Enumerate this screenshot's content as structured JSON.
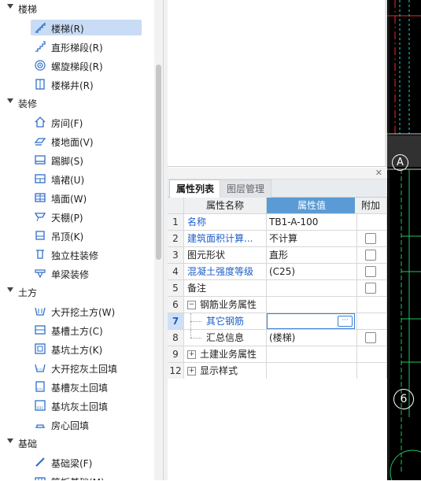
{
  "tree": {
    "groups": [
      {
        "label": "楼梯",
        "items": [
          {
            "label": "楼梯(R)",
            "icon": "stair-icon",
            "selected": true
          },
          {
            "label": "直形梯段(R)",
            "icon": "straight-flight-icon"
          },
          {
            "label": "螺旋梯段(R)",
            "icon": "spiral-flight-icon"
          },
          {
            "label": "楼梯井(R)",
            "icon": "stairwell-icon"
          }
        ]
      },
      {
        "label": "装修",
        "items": [
          {
            "label": "房间(F)",
            "icon": "room-icon"
          },
          {
            "label": "楼地面(V)",
            "icon": "floor-surface-icon"
          },
          {
            "label": "踢脚(S)",
            "icon": "skirting-icon"
          },
          {
            "label": "墙裙(U)",
            "icon": "dado-icon"
          },
          {
            "label": "墙面(W)",
            "icon": "wall-surface-icon"
          },
          {
            "label": "天棚(P)",
            "icon": "ceiling-icon"
          },
          {
            "label": "吊顶(K)",
            "icon": "suspended-ceiling-icon"
          },
          {
            "label": "独立柱装修",
            "icon": "column-finish-icon"
          },
          {
            "label": "单梁装修",
            "icon": "beam-finish-icon"
          }
        ]
      },
      {
        "label": "土方",
        "items": [
          {
            "label": "大开挖土方(W)",
            "icon": "mass-excavation-icon"
          },
          {
            "label": "基槽土方(C)",
            "icon": "trench-excavation-icon"
          },
          {
            "label": "基坑土方(K)",
            "icon": "pit-excavation-icon"
          },
          {
            "label": "大开挖灰土回填",
            "icon": "mass-backfill-icon"
          },
          {
            "label": "基槽灰土回填",
            "icon": "trench-backfill-icon"
          },
          {
            "label": "基坑灰土回填",
            "icon": "pit-backfill-icon"
          },
          {
            "label": "房心回填",
            "icon": "room-backfill-icon"
          }
        ]
      },
      {
        "label": "基础",
        "items": [
          {
            "label": "基础梁(F)",
            "icon": "foundation-beam-icon"
          },
          {
            "label": "筏板基础(M)",
            "icon": "raft-foundation-icon"
          }
        ]
      }
    ]
  },
  "properties": {
    "tabs": [
      "属性列表",
      "图层管理"
    ],
    "headers": {
      "name": "属性名称",
      "value": "属性值",
      "add": "附加"
    },
    "rows": [
      {
        "num": "1",
        "name": "名称",
        "value": "TB1-A-100",
        "blue": true,
        "check": false
      },
      {
        "num": "2",
        "name": "建筑面积计算...",
        "value": "不计算",
        "blue": true,
        "check": true
      },
      {
        "num": "3",
        "name": "图元形状",
        "value": "直形",
        "blue": false,
        "check": true
      },
      {
        "num": "4",
        "name": "混凝土强度等级",
        "value": "(C25)",
        "blue": true,
        "check": true
      },
      {
        "num": "5",
        "name": "备注",
        "value": "",
        "blue": false,
        "check": true
      },
      {
        "num": "6",
        "name": "钢筋业务属性",
        "value": "",
        "blue": false,
        "check": false,
        "expander": "−"
      },
      {
        "num": "7",
        "name": "其它钢筋",
        "value": "",
        "blue": true,
        "check": false,
        "active": true
      },
      {
        "num": "8",
        "name": "汇总信息",
        "value": "(楼梯)",
        "blue": false,
        "check": true
      },
      {
        "num": "9",
        "name": "土建业务属性",
        "value": "",
        "blue": false,
        "check": false,
        "expander": "+"
      },
      {
        "num": "12",
        "name": "显示样式",
        "value": "",
        "blue": false,
        "check": false,
        "expander": "+"
      }
    ]
  },
  "cad": {
    "axis_label_a": "A",
    "axis_label_6": "6"
  },
  "colors": {
    "selection": "#c9dcf5",
    "header_value": "#5b9bd5",
    "link_blue": "#1f5fc9",
    "cad_bg": "#000000",
    "cad_green": "#22c55e",
    "cad_cyan": "#22d3d3",
    "cad_red": "#e03030"
  }
}
